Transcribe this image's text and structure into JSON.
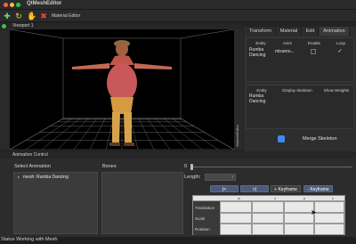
{
  "window": {
    "title": "QtMeshEditor"
  },
  "toolbar": {
    "material_editor_label": "Material Editor"
  },
  "viewport": {
    "label": "Viewport 1",
    "side_label": "MaterialEditor"
  },
  "tabs": [
    {
      "label": "Transform",
      "active": false
    },
    {
      "label": "Material",
      "active": false
    },
    {
      "label": "Edit",
      "active": false
    },
    {
      "label": "Animation",
      "active": true
    }
  ],
  "anim_table": {
    "headers": [
      "Entity",
      "Anim",
      "Enable",
      "Loop"
    ],
    "rows": [
      {
        "entity": "Rumba Dancing",
        "anim": "mixamo...",
        "loop": "✓"
      }
    ]
  },
  "skeleton_table": {
    "headers": [
      "Entity",
      "Display Skeleton",
      "Show Weights"
    ],
    "rows": [
      {
        "entity": "Rumba Dancing"
      }
    ]
  },
  "merge_button": "Merge Skeleton",
  "anim_control": {
    "title": "Animation Control",
    "select_label": "Select Animation",
    "bones_label": "Bones",
    "tree_item": "mesh: Rumba Dancing",
    "slider_value": "0",
    "length_label": "Length:",
    "btn_first": "|<",
    "btn_last": ">|",
    "btn_add_key": "+ Keyframe",
    "btn_remove_key": "- Keyframe",
    "grid_cols": [
      "w",
      "x",
      "y",
      "z"
    ],
    "grid_rows": [
      "Translation",
      "Scale",
      "Rotation"
    ]
  },
  "status": "Status Working with Mesh"
}
